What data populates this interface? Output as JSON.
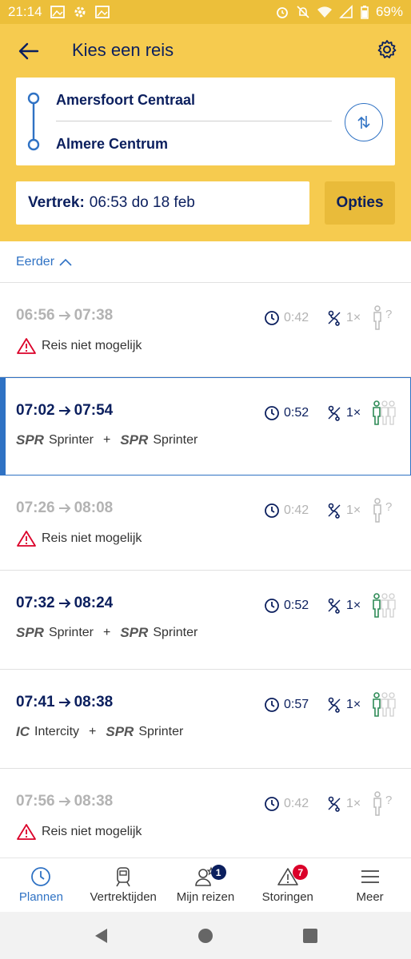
{
  "status_bar": {
    "time": "21:14",
    "battery": "69%"
  },
  "header": {
    "title": "Kies een reis"
  },
  "route": {
    "from": "Amersfoort Centraal",
    "to": "Almere Centrum"
  },
  "departure": {
    "label": "Vertrek:",
    "value": "06:53 do 18 feb"
  },
  "options_label": "Opties",
  "earlier_label": "Eerder",
  "trips": [
    {
      "depart": "06:56",
      "arrive": "07:38",
      "duration": "0:42",
      "transfers": "1×",
      "status": "Reis niet mogelijk"
    },
    {
      "depart": "07:02",
      "arrive": "07:54",
      "duration": "0:52",
      "transfers": "1×",
      "leg1_cat": "SPR",
      "leg1_name": "Sprinter",
      "leg2_cat": "SPR",
      "leg2_name": "Sprinter"
    },
    {
      "depart": "07:26",
      "arrive": "08:08",
      "duration": "0:42",
      "transfers": "1×",
      "status": "Reis niet mogelijk"
    },
    {
      "depart": "07:32",
      "arrive": "08:24",
      "duration": "0:52",
      "transfers": "1×",
      "leg1_cat": "SPR",
      "leg1_name": "Sprinter",
      "leg2_cat": "SPR",
      "leg2_name": "Sprinter"
    },
    {
      "depart": "07:41",
      "arrive": "08:38",
      "duration": "0:57",
      "transfers": "1×",
      "leg1_cat": "IC",
      "leg1_name": "Intercity",
      "leg2_cat": "SPR",
      "leg2_name": "Sprinter"
    },
    {
      "depart": "07:56",
      "arrive": "08:38",
      "duration": "0:42",
      "transfers": "1×",
      "status": "Reis niet mogelijk"
    }
  ],
  "tabs": [
    {
      "label": "Plannen"
    },
    {
      "label": "Vertrektijden"
    },
    {
      "label": "Mijn reizen",
      "badge": "1"
    },
    {
      "label": "Storingen",
      "badge": "7"
    },
    {
      "label": "Meer"
    }
  ],
  "colors": {
    "yellow": "#f6cb4f",
    "navy": "#0b1f5e",
    "blue": "#2f72c4",
    "green": "#2e8b57",
    "red": "#db0029"
  }
}
